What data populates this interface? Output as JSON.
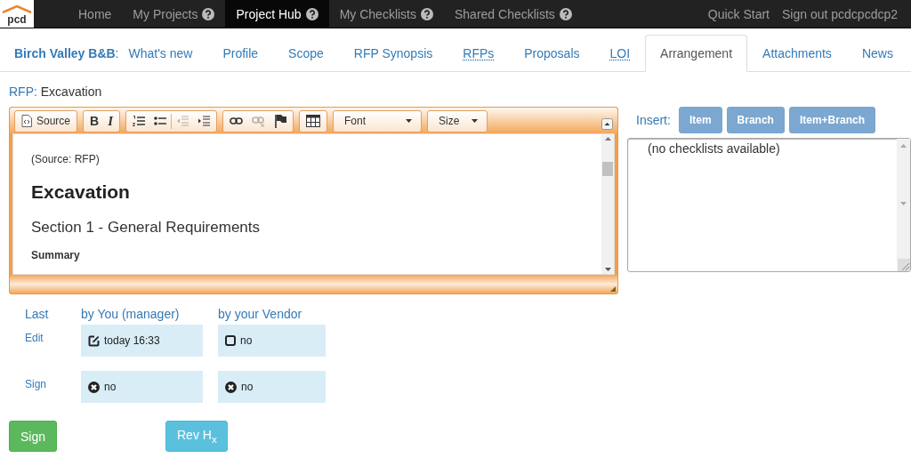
{
  "navbar": {
    "logo": "pcd",
    "items": [
      {
        "label": "Home",
        "help": false,
        "selected": false
      },
      {
        "label": "My Projects",
        "help": true,
        "selected": false
      },
      {
        "label": "Project Hub",
        "help": true,
        "selected": true
      },
      {
        "label": "My Checklists",
        "help": true,
        "selected": false
      },
      {
        "label": "Shared Checklists",
        "help": true,
        "selected": false
      }
    ],
    "right_items": [
      "Quick Start",
      "Sign out pcdcpcdcp2"
    ]
  },
  "tabs": {
    "project": "**Birch Valley B&B**:",
    "items": [
      {
        "label": "What's new",
        "abbr": false,
        "selected": false
      },
      {
        "label": "Profile",
        "abbr": false,
        "selected": false
      },
      {
        "label": "Scope",
        "abbr": false,
        "selected": false
      },
      {
        "label": "RFP Synopsis",
        "abbr": false,
        "selected": false
      },
      {
        "label": "RFPs",
        "abbr": true,
        "selected": false
      },
      {
        "label": "Proposals",
        "abbr": false,
        "selected": false
      },
      {
        "label": "LOI",
        "abbr": true,
        "selected": false
      },
      {
        "label": "Arrangement",
        "abbr": false,
        "selected": true
      },
      {
        "label": "Attachments",
        "abbr": false,
        "selected": false
      },
      {
        "label": "News",
        "abbr": false,
        "selected": false
      }
    ]
  },
  "rfp": {
    "label": "RFP:",
    "value": "Excavation"
  },
  "editor": {
    "toolbar": [
      {
        "buttons": [
          {
            "kind": "source",
            "label": "Source",
            "disabled": false
          }
        ]
      },
      {
        "buttons": [
          {
            "kind": "bold",
            "label": "B",
            "disabled": false
          },
          {
            "kind": "italic",
            "label": "I",
            "disabled": false
          }
        ]
      },
      {
        "buttons": [
          {
            "kind": "numbered-list",
            "disabled": false
          },
          {
            "kind": "bullet-list",
            "disabled": false
          },
          {
            "kind": "outdent",
            "disabled": true
          },
          {
            "kind": "indent",
            "disabled": false
          }
        ]
      },
      {
        "buttons": [
          {
            "kind": "link",
            "disabled": false
          },
          {
            "kind": "unlink",
            "disabled": true
          },
          {
            "kind": "flag",
            "disabled": false
          }
        ]
      },
      {
        "buttons": [
          {
            "kind": "table",
            "disabled": false
          }
        ]
      },
      {
        "buttons": [
          {
            "kind": "dropdown",
            "label": "Font",
            "disabled": false
          }
        ]
      },
      {
        "buttons": [
          {
            "kind": "dropdown",
            "label": "Size",
            "disabled": false
          }
        ]
      }
    ],
    "content": [
      {
        "kind": "note",
        "text": "(Source: RFP)"
      },
      {
        "kind": "heading",
        "text": "Excavation"
      },
      {
        "kind": "subheading",
        "text": "Section 1 - General Requirements"
      },
      {
        "kind": "label",
        "text": "Summary"
      }
    ]
  },
  "insert": {
    "label": "Insert:",
    "buttons": [
      "Item",
      "Branch",
      "Item+Branch"
    ],
    "list_text": "(no checklists available)"
  },
  "status": {
    "corner": "Last",
    "columns": [
      "by You (manager)",
      "by your Vendor"
    ],
    "rows": [
      {
        "kind": "edit",
        "label": "Edit",
        "cells": [
          {
            "done": true,
            "text": "today 16:33"
          },
          {
            "done": false,
            "text": "no"
          }
        ]
      },
      {
        "kind": "sign",
        "label": "Sign",
        "cells": [
          {
            "done": false,
            "text": "no"
          },
          {
            "done": false,
            "text": "no"
          }
        ]
      }
    ]
  },
  "actions": [
    {
      "kind": "success",
      "label": "Sign"
    },
    {
      "kind": "info",
      "label": "Rev H$_{x}$"
    }
  ]
}
